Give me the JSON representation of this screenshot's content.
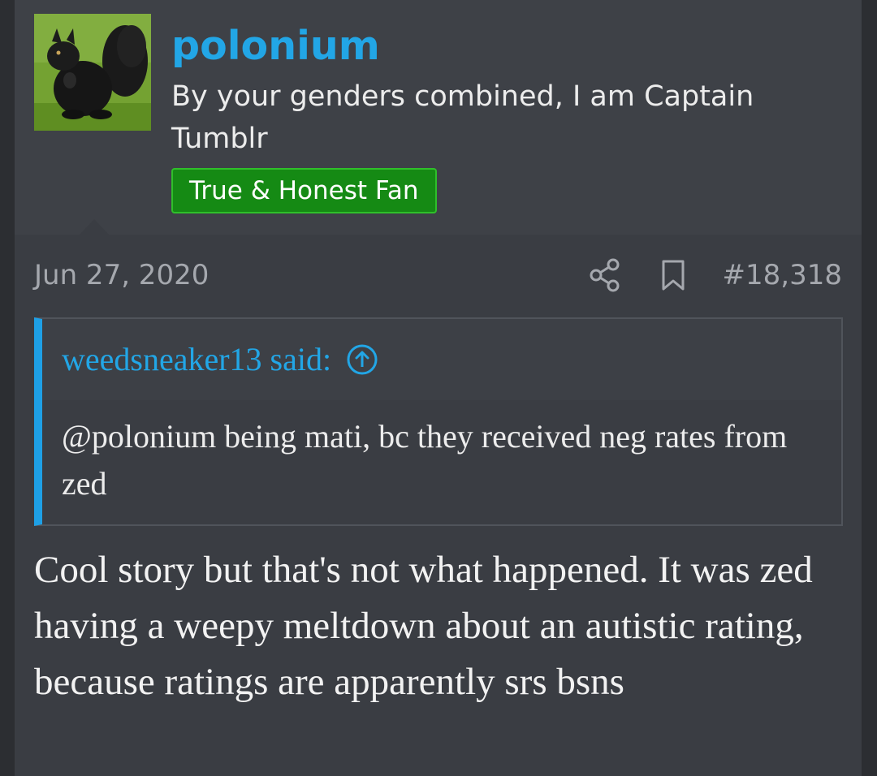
{
  "user": {
    "avatar_icon": "black-squirrel-avatar",
    "username": "polonium",
    "title": "By your genders combined, I am Captain Tumblr",
    "banner": "True & Honest Fan"
  },
  "post": {
    "date": "Jun 27, 2020",
    "share_icon": "share-icon",
    "bookmark_icon": "bookmark-icon",
    "number": "#18,318",
    "message": "Cool story but that's not what happened. It was zed having a weepy meltdown about an autistic rating, because ratings are apparently srs bsns"
  },
  "quote": {
    "author": "weedsneaker13 said:",
    "expand_icon": "arrow-up-circle-icon",
    "text": "@polonium being mati, bc they received neg rates from zed"
  },
  "colors": {
    "link": "#22a6e6",
    "banner_bg": "#158a14",
    "quote_border": "#1ea0e6"
  }
}
